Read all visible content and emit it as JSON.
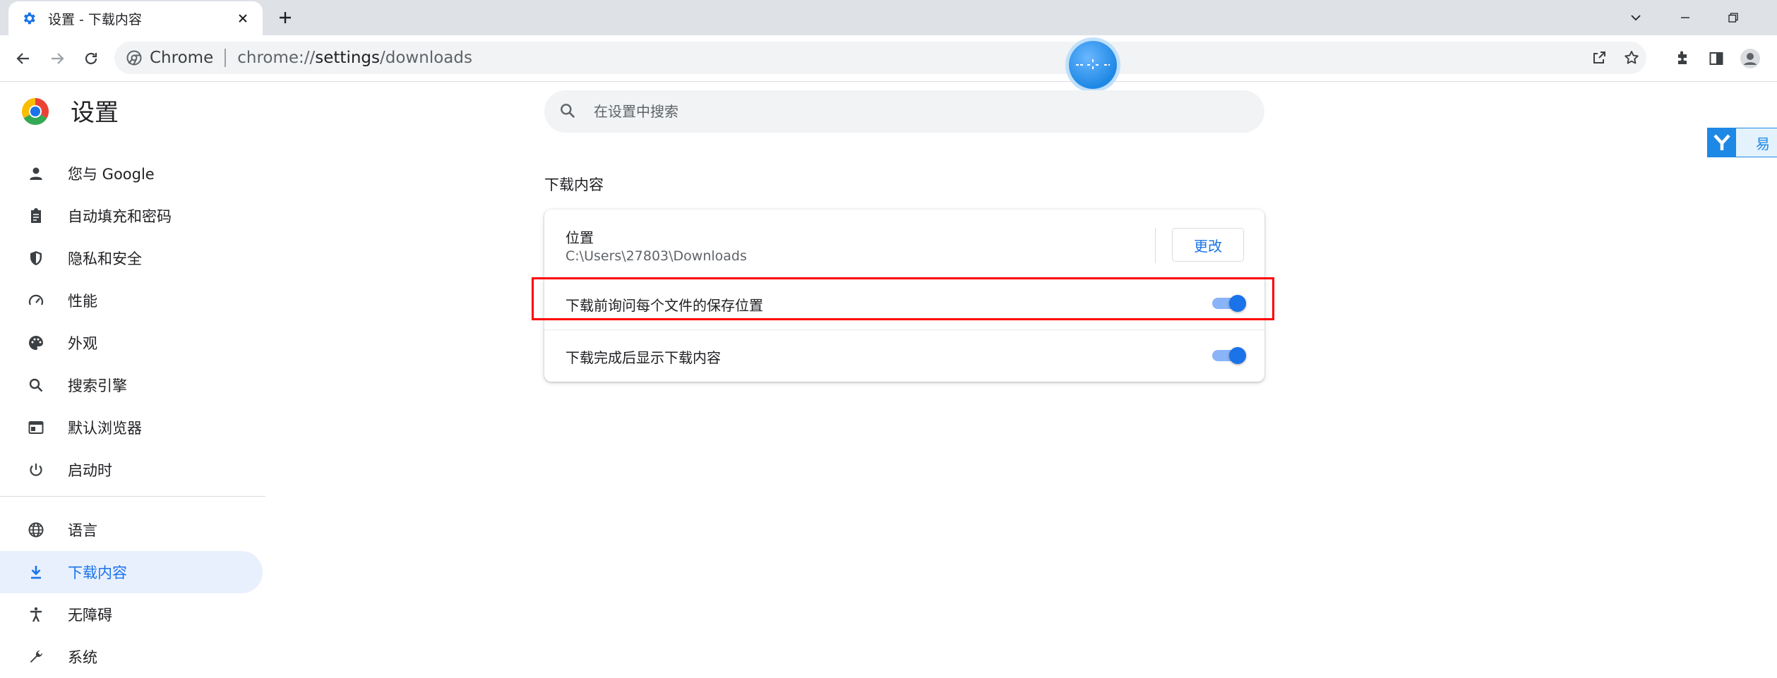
{
  "browser": {
    "tab": {
      "title": "设置 - 下载内容"
    },
    "omnibox": {
      "site_name": "Chrome",
      "url_scheme": "chrome://",
      "url_host": "settings",
      "url_path": "/downloads"
    }
  },
  "settings": {
    "title": "设置",
    "search_placeholder": "在设置中搜索",
    "sidebar": {
      "items": [
        {
          "label": "您与 Google",
          "icon": "person-icon"
        },
        {
          "label": "自动填充和密码",
          "icon": "clipboard-icon"
        },
        {
          "label": "隐私和安全",
          "icon": "shield-icon"
        },
        {
          "label": "性能",
          "icon": "speedometer-icon"
        },
        {
          "label": "外观",
          "icon": "palette-icon"
        },
        {
          "label": "搜索引擎",
          "icon": "search-icon"
        },
        {
          "label": "默认浏览器",
          "icon": "browser-window-icon"
        },
        {
          "label": "启动时",
          "icon": "power-icon"
        },
        {
          "label": "语言",
          "icon": "globe-icon"
        },
        {
          "label": "下载内容",
          "icon": "download-icon",
          "active": true
        },
        {
          "label": "无障碍",
          "icon": "accessibility-icon"
        },
        {
          "label": "系统",
          "icon": "wrench-icon"
        }
      ]
    },
    "downloads": {
      "section_title": "下载内容",
      "location_label": "位置",
      "location_path": "C:\\Users\\27803\\Downloads",
      "change_button": "更改",
      "ask_where_to_save": {
        "label": "下载前询问每个文件的保存位置",
        "enabled": true
      },
      "show_when_done": {
        "label": "下载完成后显示下载内容",
        "enabled": true
      }
    }
  },
  "youdao_widget": {
    "logo": "Y",
    "label": "易"
  },
  "colors": {
    "accent": "#1a73e8",
    "highlight": "#ff0000",
    "active_nav_bg": "#e8f0fe"
  }
}
